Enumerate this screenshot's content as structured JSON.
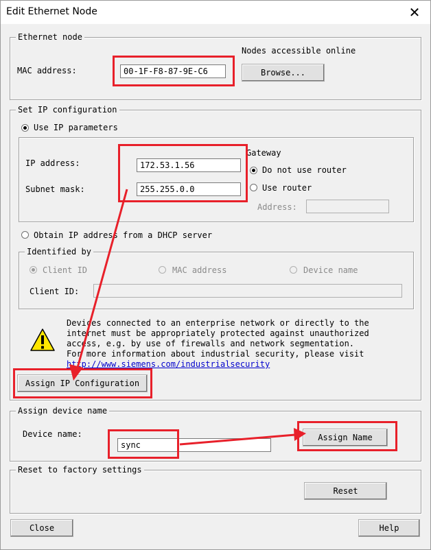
{
  "window": {
    "title": "Edit Ethernet Node",
    "close_glyph": "✕"
  },
  "ethernet_node": {
    "legend": "Ethernet node",
    "mac_label": "MAC address:",
    "mac_value": "00-1F-F8-87-9E-C6",
    "online_label": "Nodes accessible online",
    "browse_label": "Browse..."
  },
  "set_ip": {
    "legend": "Set IP configuration",
    "use_ip_label": "Use IP parameters",
    "use_ip_selected": true,
    "ip_label": "IP address:",
    "ip_value": "172.53.1.56",
    "subnet_label": "Subnet mask:",
    "subnet_value": "255.255.0.0",
    "gateway_legend": "Gateway",
    "no_router_label": "Do not use router",
    "no_router_selected": true,
    "use_router_label": "Use router",
    "address_label": "Address:",
    "address_value": "",
    "dhcp_label": "Obtain IP address from a DHCP server",
    "identified_legend": "Identified by",
    "client_id_radio": "Client ID",
    "mac_radio": "MAC address",
    "device_name_radio": "Device name",
    "client_id_label": "Client ID:",
    "client_id_value": "",
    "warning_lines": [
      "Devices connected to an enterprise network or directly to the",
      "internet must be appropriately protected against unauthorized",
      "access, e.g. by use of firewalls and network segmentation.",
      "For more information about industrial security, please visit"
    ],
    "warning_link": "http://www.siemens.com/industrialsecurity",
    "warning_icon": "warning-icon",
    "assign_ip_label": "Assign IP Configuration"
  },
  "device_name": {
    "legend": "Assign device name",
    "label": "Device name:",
    "value": "sync",
    "assign_label": "Assign Name"
  },
  "factory": {
    "legend": "Reset to factory settings",
    "reset_label": "Reset"
  },
  "footer": {
    "close_label": "Close",
    "help_label": "Help"
  },
  "annotation_color": "#e8202a"
}
